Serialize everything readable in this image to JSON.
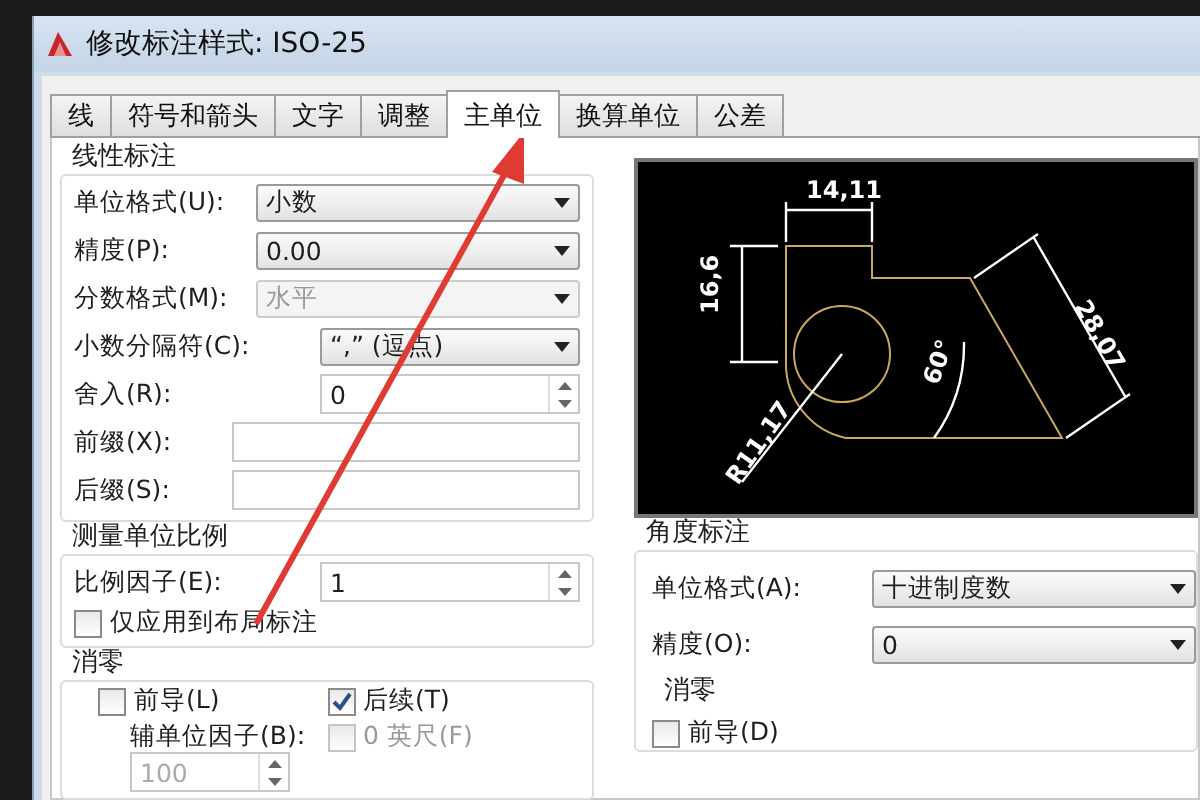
{
  "window": {
    "title": "修改标注样式: ISO-25"
  },
  "tabs": [
    {
      "label": "线",
      "selected": false
    },
    {
      "label": "符号和箭头",
      "selected": false
    },
    {
      "label": "文字",
      "selected": false
    },
    {
      "label": "调整",
      "selected": false
    },
    {
      "label": "主单位",
      "selected": true
    },
    {
      "label": "换算单位",
      "selected": false
    },
    {
      "label": "公差",
      "selected": false
    }
  ],
  "linear": {
    "title": "线性标注",
    "rows": [
      {
        "kind": "combo",
        "label": "单位格式(U):",
        "value": "小数",
        "disabled": false
      },
      {
        "kind": "combo",
        "label": "精度(P):",
        "value": "0.00",
        "disabled": false
      },
      {
        "kind": "combo",
        "label": "分数格式(M):",
        "value": "水平",
        "disabled": true
      },
      {
        "kind": "combo-short",
        "label": "小数分隔符(C):",
        "value": "“,” (逗点)",
        "disabled": false
      },
      {
        "kind": "spin",
        "label": "舍入(R):",
        "value": "0"
      },
      {
        "kind": "text",
        "label": "前缀(X):"
      },
      {
        "kind": "text",
        "label": "后缀(S):"
      }
    ]
  },
  "scale": {
    "title": "测量单位比例",
    "factor_label": "比例因子(E):",
    "factor": "1",
    "layout_only": {
      "label": "仅应用到布局标注",
      "checked": false,
      "disabled": false
    }
  },
  "zero": {
    "title": "消零",
    "leading": {
      "label": "前导(L)",
      "checked": false,
      "disabled": false
    },
    "trailing": {
      "label": "后续(T)",
      "checked": true,
      "disabled": false
    },
    "sub_label": "辅单位因子(B):",
    "sub_factor": "100",
    "sub_disabled": true,
    "feet": {
      "label": "0 英尺(F)",
      "checked": false,
      "disabled": true
    }
  },
  "preview": {
    "labels": [
      "14,11",
      "16,6",
      "28,07",
      "60°",
      "R11,17"
    ]
  },
  "angular": {
    "title": "角度标注",
    "rows": [
      {
        "kind": "combo",
        "label": "单位格式(A):",
        "value": "十进制度数",
        "disabled": false
      },
      {
        "kind": "combo",
        "label": "精度(O):",
        "value": "0",
        "disabled": false
      }
    ],
    "zero_title": "消零",
    "leading": {
      "label": "前导(D)",
      "checked": false,
      "disabled": false
    }
  }
}
